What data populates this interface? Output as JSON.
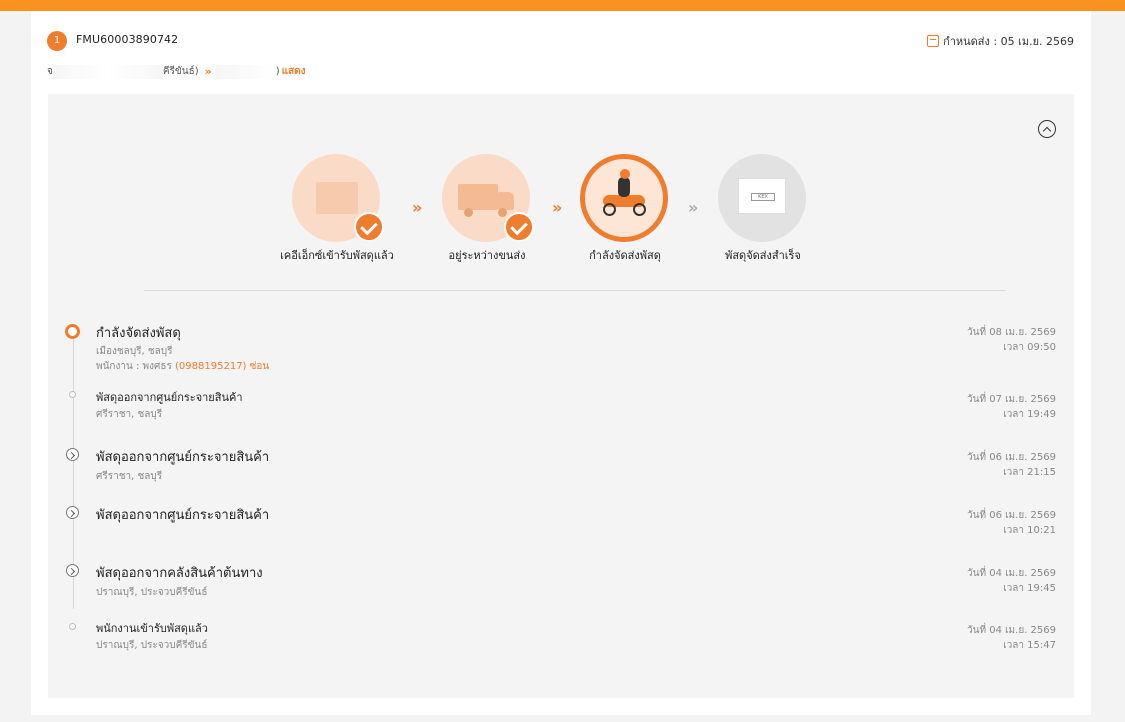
{
  "header": {
    "index": "1",
    "tracking_no": "FMU60003890742",
    "due_label": "กำหนดส่ง : 05 เม.ย. 2569",
    "route_prefix": "จ",
    "route_origin_suffix": "คีรีขันธ์)",
    "route_arrow": "»",
    "route_dest_suffix": ")",
    "show_label": "แสดง"
  },
  "steps": [
    {
      "label": "เคอีเอ็กซ์เข้ารับพัสดุแล้ว",
      "state": "done",
      "icon": "parcel-pickup-icon"
    },
    {
      "label": "อยู่ระหว่างขนส่ง",
      "state": "done",
      "icon": "truck-icon"
    },
    {
      "label": "กำลังจัดส่งพัสดุ",
      "state": "current",
      "icon": "delivery-rider-icon"
    },
    {
      "label": "พัสดุจัดส่งสำเร็จ",
      "state": "pending",
      "icon": "delivered-box-icon"
    }
  ],
  "step_box_tag": "KEX",
  "colors": {
    "accent": "#f07c2d",
    "topbar": "#f7931e"
  },
  "events": [
    {
      "title": "กำลังจัดส่งพัสดุ",
      "location": "เมืองชลบุรี, ชลบุรี",
      "staff_prefix": "พนักงาน : พงศธร",
      "staff_phone": "(0988195217) ซ่อน",
      "date": "วันที่ 08 เม.ย. 2569",
      "time": "เวลา 09:50"
    },
    {
      "title": "พัสดุออกจากศูนย์กระจายสินค้า",
      "location": "ศรีราชา, ชลบุรี",
      "date": "วันที่ 07 เม.ย. 2569",
      "time": "เวลา 19:49"
    },
    {
      "title": "พัสดุออกจากศูนย์กระจายสินค้า",
      "location": "ศรีราชา, ชลบุรี",
      "date": "วันที่ 06 เม.ย. 2569",
      "time": "เวลา 21:15"
    },
    {
      "title": "พัสดุออกจากศูนย์กระจายสินค้า",
      "location": "",
      "date": "วันที่ 06 เม.ย. 2569",
      "time": "เวลา 10:21"
    },
    {
      "title": "พัสดุออกจากคลังสินค้าต้นทาง",
      "location": "ปราณบุรี, ประจวบคีรีขันธ์",
      "date": "วันที่ 04 เม.ย. 2569",
      "time": "เวลา 19:45"
    },
    {
      "title": "พนักงานเข้ารับพัสดุแล้ว",
      "location": "ปราณบุรี, ประจวบคีรีขันธ์",
      "date": "วันที่ 04 เม.ย. 2569",
      "time": "เวลา 15:47"
    }
  ]
}
